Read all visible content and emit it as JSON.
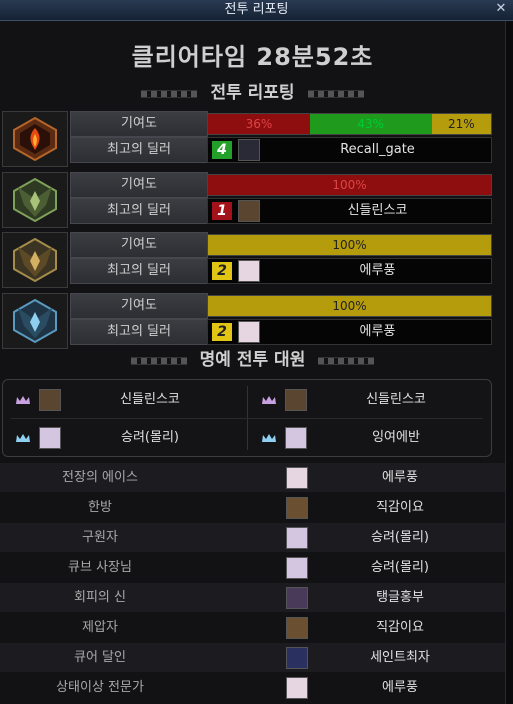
{
  "window": {
    "title": "전투 리포팅",
    "close_glyph": "✕"
  },
  "clear_time": "클리어타임  28분52초",
  "reports_header": "전투 리포팅",
  "contribution_label": "기여도",
  "best_dealer_label": "최고의 딜러",
  "parties": [
    {
      "emblem": "flame-emblem-icon",
      "contribution": [
        {
          "label": "36%",
          "value": 36,
          "color": "red"
        },
        {
          "label": "43%",
          "value": 43,
          "color": "green"
        },
        {
          "label": "21%",
          "value": 21,
          "color": "gold"
        }
      ],
      "dealer_rank": "4",
      "rank_color": "green",
      "dealer_name": "Recall_gate"
    },
    {
      "emblem": "green-blade-emblem-icon",
      "contribution": [
        {
          "label": "100%",
          "value": 100,
          "color": "red"
        }
      ],
      "dealer_rank": "1",
      "rank_color": "red",
      "dealer_name": "신들린스코"
    },
    {
      "emblem": "gold-blade-emblem-icon",
      "contribution": [
        {
          "label": "100%",
          "value": 100,
          "color": "gold"
        }
      ],
      "dealer_rank": "2",
      "rank_color": "yellow",
      "dealer_name": "에루풍"
    },
    {
      "emblem": "blue-blade-emblem-icon",
      "contribution": [
        {
          "label": "100%",
          "value": 100,
          "color": "gold"
        }
      ],
      "dealer_rank": "2",
      "rank_color": "yellow",
      "dealer_name": "에루풍"
    }
  ],
  "honor_header": "명예 전투 대원",
  "honor_members": [
    "신들린스코",
    "신들린스코",
    "승려(몰리)",
    "잉여에반"
  ],
  "titles": [
    {
      "title": "전장의 에이스",
      "player": "에루풍"
    },
    {
      "title": "한방",
      "player": "직감이요"
    },
    {
      "title": "구원자",
      "player": "승려(몰리)"
    },
    {
      "title": "큐브 사장님",
      "player": "승려(몰리)"
    },
    {
      "title": "회피의 신",
      "player": "탱글홍부"
    },
    {
      "title": "제압자",
      "player": "직감이요"
    },
    {
      "title": "큐어 달인",
      "player": "세인트최자"
    },
    {
      "title": "상태이상 전문가",
      "player": "에루풍"
    }
  ],
  "colors": {
    "red": "#8e0e10",
    "green": "#1f9a1c",
    "gold": "#b59c0c"
  }
}
